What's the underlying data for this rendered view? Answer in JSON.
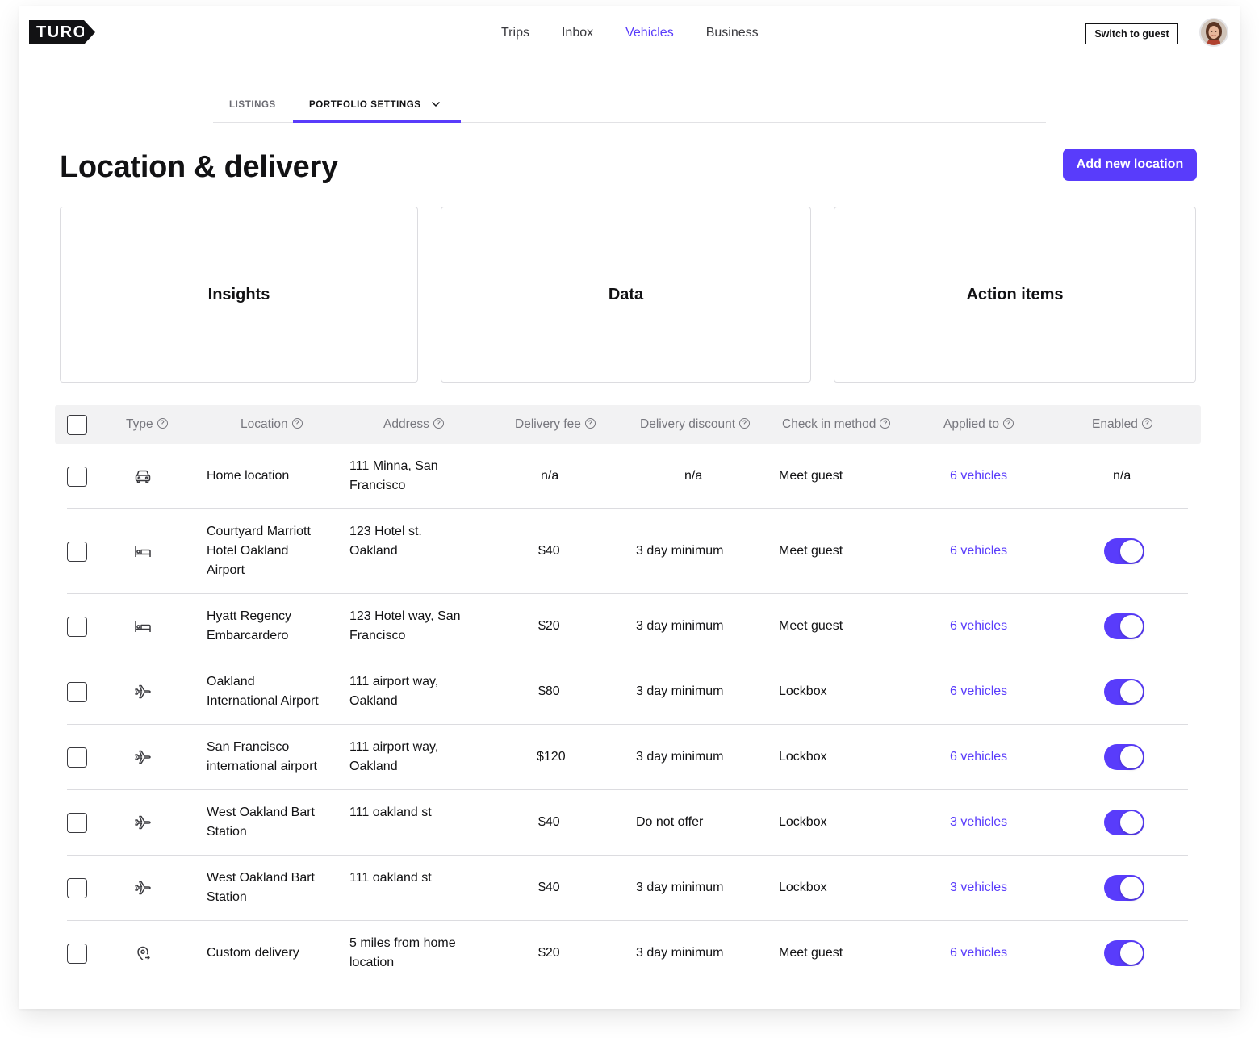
{
  "brand": {
    "logo_text": "TURO",
    "accent": "#593cfb"
  },
  "topnav": {
    "items": [
      {
        "label": "Trips",
        "active": false
      },
      {
        "label": "Inbox",
        "active": false
      },
      {
        "label": "Vehicles",
        "active": true
      },
      {
        "label": "Business",
        "active": false
      }
    ],
    "switch_label": "Switch to guest"
  },
  "subtabs": {
    "listings": "LISTINGS",
    "portfolio": "PORTFOLIO SETTINGS"
  },
  "page": {
    "title": "Location & delivery",
    "add_button": "Add new location"
  },
  "cards": [
    "Insights",
    "Data",
    "Action items"
  ],
  "table": {
    "headers": {
      "type": "Type",
      "location": "Location",
      "address": "Address",
      "fee": "Delivery fee",
      "discount": "Delivery discount",
      "checkin": "Check in method",
      "applied": "Applied to",
      "enabled": "Enabled"
    },
    "help_glyph": "?",
    "rows": [
      {
        "icon": "car-icon",
        "location": "Home location",
        "address": "111 Minna, San Francisco",
        "fee": "n/a",
        "discount": "n/a",
        "checkin": "Meet guest",
        "applied": "6 vehicles",
        "enabled_text": "n/a",
        "enabled": null
      },
      {
        "icon": "hotel-bed-icon",
        "location": "Courtyard Marriott Hotel Oakland Airport",
        "address": "123 Hotel st. Oakland",
        "fee": "$40",
        "discount": "3 day minimum",
        "checkin": "Meet guest",
        "applied": "6 vehicles",
        "enabled": true
      },
      {
        "icon": "hotel-bed-icon",
        "location": "Hyatt Regency Embarcardero",
        "address": "123 Hotel way, San Francisco",
        "fee": "$20",
        "discount": "3 day minimum",
        "checkin": "Meet guest",
        "applied": "6 vehicles",
        "enabled": true
      },
      {
        "icon": "airplane-icon",
        "location": "Oakland International Airport",
        "address": "111 airport way, Oakland",
        "fee": "$80",
        "discount": "3 day minimum",
        "checkin": "Lockbox",
        "applied": "6 vehicles",
        "enabled": true
      },
      {
        "icon": "airplane-icon",
        "location": "San Francisco international airport",
        "address": "111 airport way, Oakland",
        "fee": "$120",
        "discount": "3 day minimum",
        "checkin": "Lockbox",
        "applied": "6 vehicles",
        "enabled": true
      },
      {
        "icon": "train-icon",
        "location": "West Oakland Bart Station",
        "address": "111 oakland st",
        "fee": "$40",
        "discount": "Do not offer",
        "checkin": "Lockbox",
        "applied": "3 vehicles",
        "enabled": true
      },
      {
        "icon": "train-icon",
        "location": "West Oakland Bart Station",
        "address": "111 oakland st",
        "fee": "$40",
        "discount": "3 day minimum",
        "checkin": "Lockbox",
        "applied": "3 vehicles",
        "enabled": true
      },
      {
        "icon": "location-pin-icon",
        "location": "Custom delivery",
        "address": "5 miles from home location",
        "fee": "$20",
        "discount": "3 day minimum",
        "checkin": "Meet guest",
        "applied": "6 vehicles",
        "enabled": true
      }
    ]
  }
}
